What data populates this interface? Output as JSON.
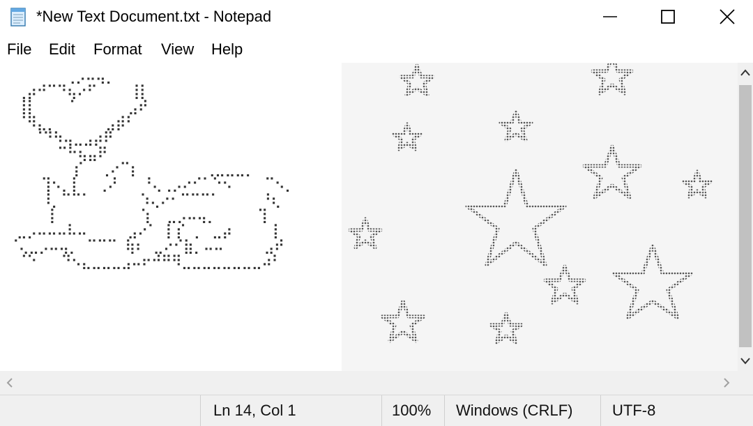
{
  "window": {
    "title": "*New Text Document.txt - Notepad",
    "app_icon": "notepad-icon",
    "controls": [
      "minimize-icon",
      "maximize-icon",
      "close-icon"
    ]
  },
  "menu": {
    "file": "File",
    "edit": "Edit",
    "format": "Format",
    "view": "View",
    "help": "Help"
  },
  "editor": {
    "ascii_art": "       ⢀⡠⠤⢤⡀\n ⢀⡴⠚⠉⠙⢦⠔⠋    ⢸⡇\n ⢸⡇    ⠁      ⣠⠞\n ⠈⠻⣄⡀      ⣠⡾⠃\n   ⠈⠙⠳⢤⣀⣠⡴⠟\n      ⠉⠓⢦⣤⠟\n        ⡎  ⢀⠔⠉⡆        ⢀⣀⣀⣀⡀\n    ⢹⠢⡀⡇  ⢀⠜   ⠘⢄⢀⡠⠔⠊⠁⠑⠢    ⠉⠢⡀\n    ⠸⡀⠉⠉⠁      ⠱⢄⠔⠂⠉⠉⠉⠁     ⠘⢆\n     ⡇          ⢱  ⣀⡠⠤⢤⡀     ⢹\n ⣀⡠⠤⠤⠤⠧⠤     ⣠⠔⠁ ⡇⡎ ⡀ ⣀⡴     ⡇\n⠈⢄⣀⡠⠤⢤⡀ ⠉⠉⠉ ⢷⠆ ⣀⠔⠊⣷⡀⠤⠤     ⣠⠞\n ⠈⠑   ⠙⠢⣄⣀⣀⣀⣠⠤⠖⠚⠛⠻⣀⣀⣀⣀⣀⣀⣀⣀⠴⠃",
    "caret_line": 14
  },
  "status": {
    "position": "Ln 14, Col 1",
    "zoom": "100%",
    "line_ending": "Windows (CRLF)",
    "encoding": "UTF-8"
  },
  "colors": {
    "text": "#000000",
    "chrome": "#f0f0f0",
    "scroll_thumb": "#c1c1c1",
    "art": "#333333"
  }
}
